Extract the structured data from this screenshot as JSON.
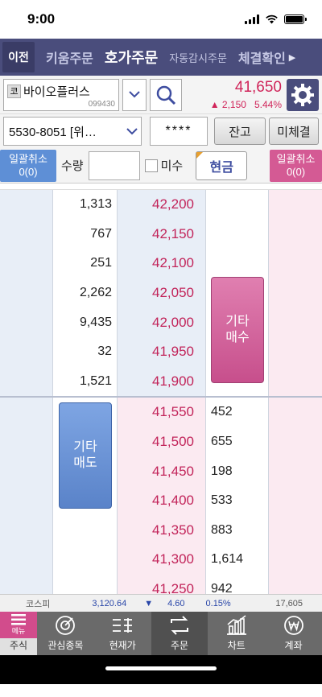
{
  "status_bar": {
    "time": "9:00"
  },
  "tabs": {
    "prev": "이전",
    "items": [
      {
        "label": "키움주문"
      },
      {
        "label": "호가주문"
      },
      {
        "label": "자동감시주문"
      },
      {
        "label": "체결확인"
      }
    ],
    "active_index": 1,
    "next_icon": "triangle-right-icon"
  },
  "stock": {
    "market_badge": "코",
    "name": "바이오플러스",
    "code": "099430",
    "price": "41,650",
    "change_arrow": "▲",
    "change": "2,150",
    "change_pct": "5.44%"
  },
  "account": {
    "number": "5530-8051 [위…",
    "password_mask": "****",
    "balance_button": "잔고",
    "unfilled_button": "미체결"
  },
  "order": {
    "bulk_cancel_left": "일괄취소\n0(0)",
    "qty_label": "수량",
    "qty_value": "",
    "misu_label": "미수",
    "cash_button": "현금",
    "bulk_cancel_right": "일괄취소\n0(0)"
  },
  "orderbook": {
    "asks": [
      {
        "qty": "1,313",
        "price": "42,200"
      },
      {
        "qty": "767",
        "price": "42,150"
      },
      {
        "qty": "251",
        "price": "42,100"
      },
      {
        "qty": "2,262",
        "price": "42,050"
      },
      {
        "qty": "9,435",
        "price": "42,000"
      },
      {
        "qty": "32",
        "price": "41,950"
      },
      {
        "qty": "1,521",
        "price": "41,900"
      }
    ],
    "bids": [
      {
        "price": "41,550",
        "qty": "452"
      },
      {
        "price": "41,500",
        "qty": "655"
      },
      {
        "price": "41,450",
        "qty": "198"
      },
      {
        "price": "41,400",
        "qty": "533"
      },
      {
        "price": "41,350",
        "qty": "883"
      },
      {
        "price": "41,300",
        "qty": "1,614"
      },
      {
        "price": "41,250",
        "qty": "942"
      }
    ],
    "etc_buy": "기타\n매수",
    "etc_sell": "기타\n매도"
  },
  "ticker": {
    "index_name": "코스피",
    "index_value": "3,120.64",
    "arrow": "▼",
    "change": "4.60",
    "change_pct": "0.15%",
    "volume": "17,605"
  },
  "bottom_nav": {
    "menu_label": "메뉴",
    "items": [
      {
        "label": "주식",
        "icon": "menu-icon"
      },
      {
        "label": "관심종목",
        "icon": "target-icon"
      },
      {
        "label": "현재가",
        "icon": "price-list-icon"
      },
      {
        "label": "주문",
        "icon": "exchange-icon"
      },
      {
        "label": "차트",
        "icon": "chart-icon"
      },
      {
        "label": "계좌",
        "icon": "won-icon"
      }
    ]
  },
  "colors": {
    "header": "#4a4d7c",
    "up_red": "#d0255a",
    "ask_blue": "#5e8fd6",
    "bid_pink": "#d45a94"
  }
}
